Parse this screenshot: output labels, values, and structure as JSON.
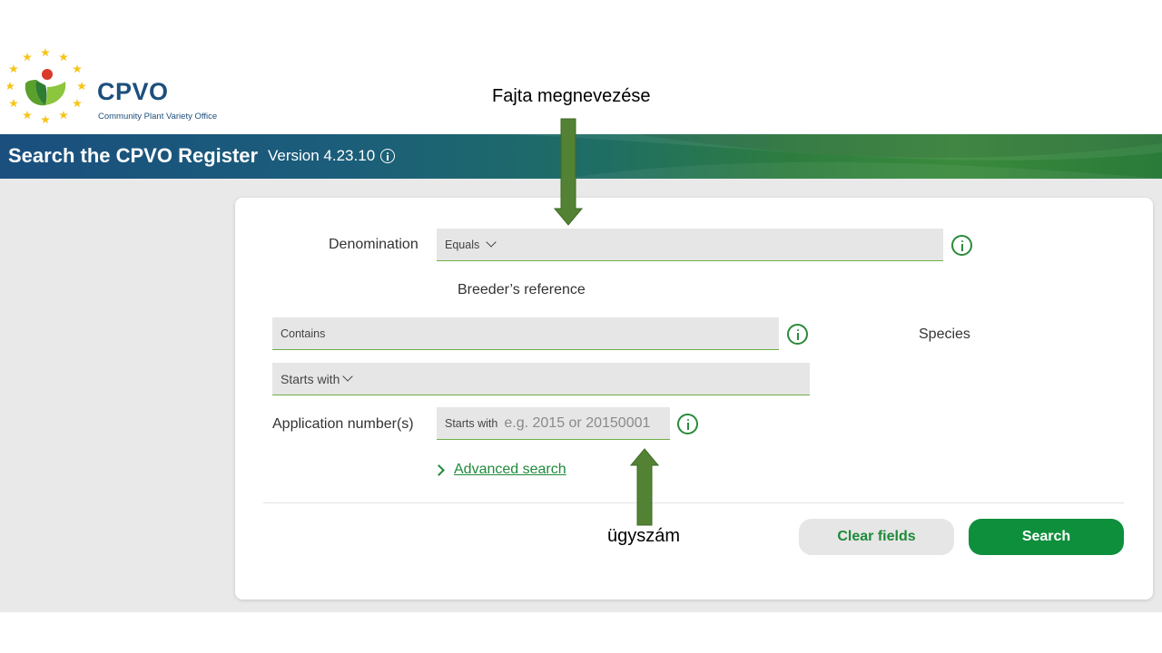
{
  "logo": {
    "title": "CPVO",
    "subtitle": "Community Plant Variety Office"
  },
  "banner": {
    "title": "Search the CPVO Register",
    "version": "Version 4.23.10"
  },
  "form": {
    "denomination": {
      "label": "Denomination",
      "operator": "Equals"
    },
    "breeders_reference": {
      "label": "Breeder’s reference",
      "operator": "Contains"
    },
    "species": {
      "label": "Species",
      "operator": "Starts with"
    },
    "application_number": {
      "label": "Application number(s)",
      "operator": "Starts with",
      "placeholder": "e.g. 2015 or 20150001"
    },
    "advanced_search": "Advanced search"
  },
  "buttons": {
    "clear": "Clear fields",
    "search": "Search"
  },
  "annotations": {
    "top": "Fajta megnevezése",
    "bottom": "ügyszám"
  },
  "colors": {
    "brand_blue": "#1d4f7c",
    "accent_green": "#0d8f3c",
    "arrow_green": "#548235"
  }
}
